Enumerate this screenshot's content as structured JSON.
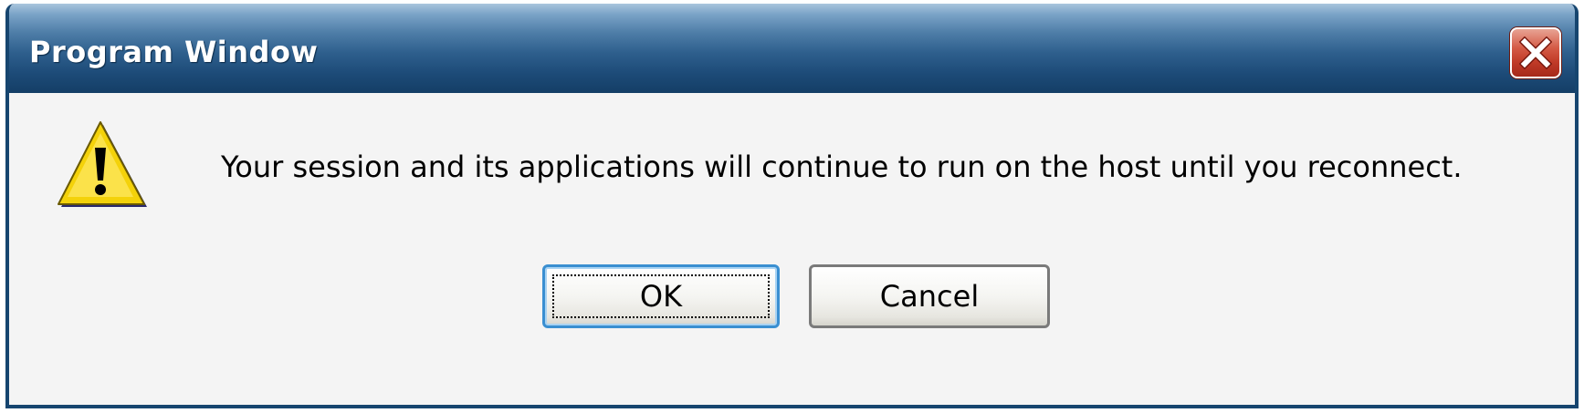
{
  "window": {
    "title": "Program Window",
    "close_icon": "close-x-icon"
  },
  "dialog": {
    "icon": "warning-icon",
    "message": "Your session and its applications will continue to run on the host until you reconnect."
  },
  "buttons": {
    "ok_label": "OK",
    "cancel_label": "Cancel"
  },
  "colors": {
    "titlebar": "#1d4b78",
    "frame": "#16456f",
    "close_button": "#c03a27",
    "warning_fill": "#f4d20a",
    "ok_focus_border": "#3a8fd1"
  }
}
